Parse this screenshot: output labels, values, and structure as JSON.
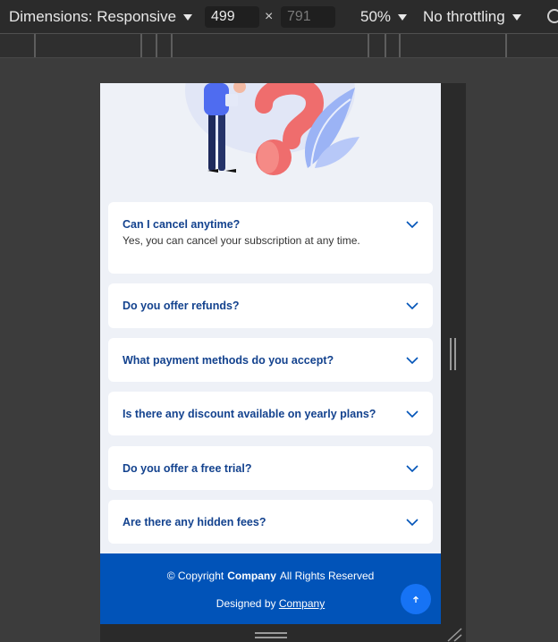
{
  "devtools": {
    "dimensions_label": "Dimensions: Responsive",
    "width_value": "499",
    "height_value": "791",
    "times": "×",
    "zoom_label": "50%",
    "throttle_label": "No throttling"
  },
  "faq": {
    "items": [
      {
        "question": "Can I cancel anytime?",
        "answer": "Yes, you can cancel your subscription at any time."
      },
      {
        "question": "Do you offer refunds?"
      },
      {
        "question": "What payment methods do you accept?"
      },
      {
        "question": "Is there any discount available on yearly plans?"
      },
      {
        "question": "Do you offer a free trial?"
      },
      {
        "question": "Are there any hidden fees?"
      }
    ]
  },
  "footer": {
    "copyright_prefix": "© Copyright",
    "company": "Company",
    "rights": "All Rights Reserved",
    "designed_by": "Designed by",
    "designed_link": "Company"
  },
  "colors": {
    "accent": "#0153b8",
    "question_text": "#13428e",
    "page_bg": "#eef1f7"
  },
  "icons": [
    "chevron-down-icon",
    "arrow-up-icon",
    "rotate-icon",
    "resize-handle-icon"
  ]
}
